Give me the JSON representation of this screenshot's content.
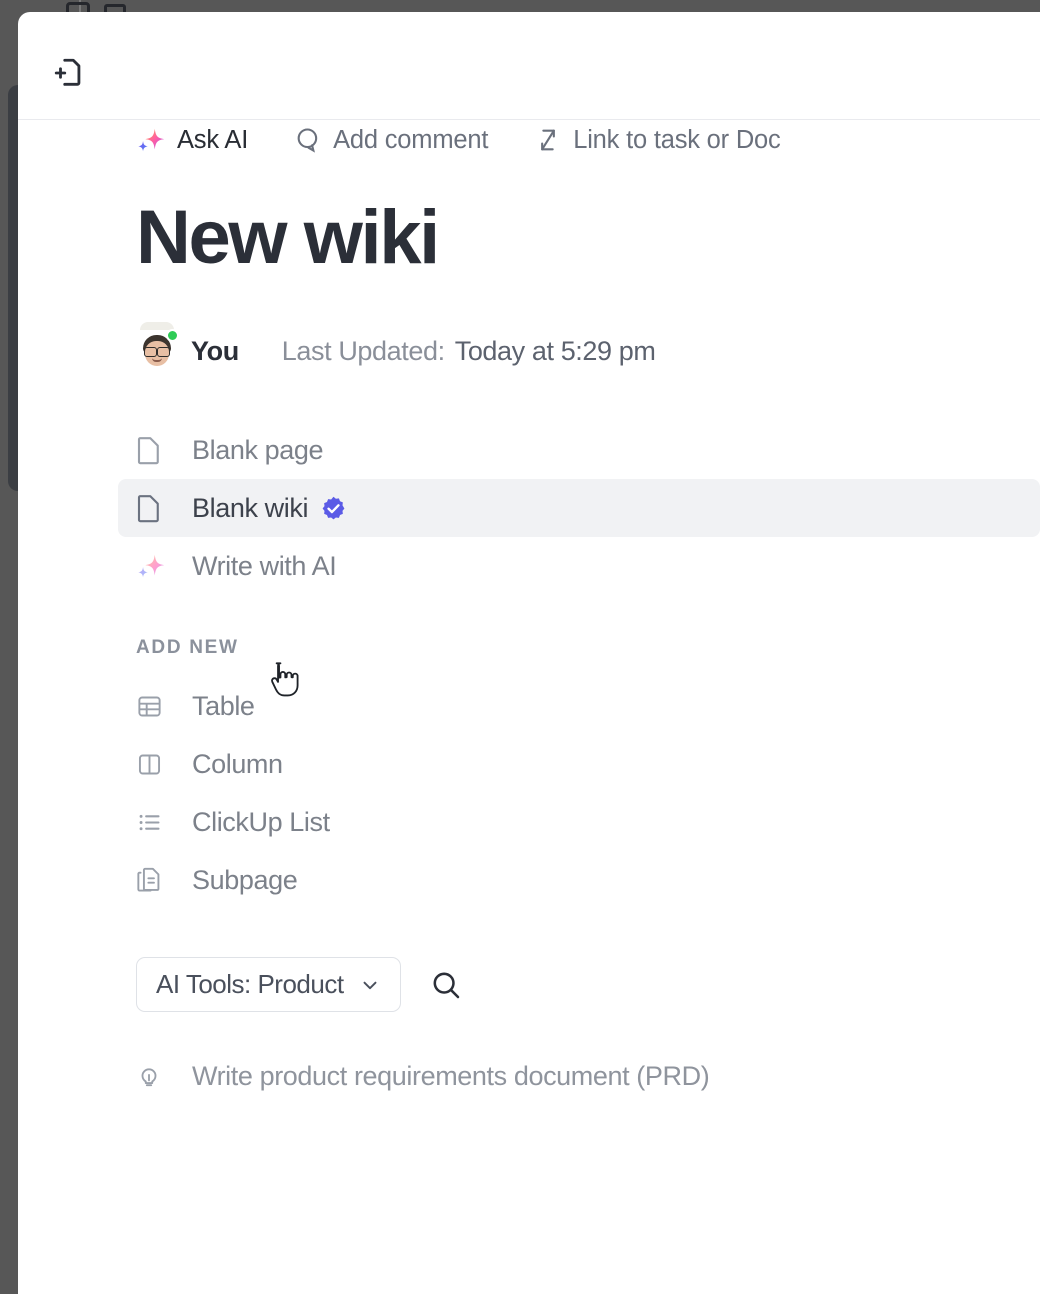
{
  "window": {
    "background_color": "#575757",
    "panel_background": "#ffffff",
    "sidebar_rail_color": "#3b3e43"
  },
  "header": {
    "new_page_icon": "new-page-icon"
  },
  "toolbar": {
    "items": [
      {
        "label": "Ask AI",
        "icon": "sparkle-icon",
        "emphasis": "dark"
      },
      {
        "label": "Add comment",
        "icon": "comment-icon",
        "emphasis": "muted"
      },
      {
        "label": "Link to task or Doc",
        "icon": "link-arrows-icon",
        "emphasis": "muted"
      }
    ]
  },
  "document": {
    "title": "New wiki",
    "author": "You",
    "updated_label": "Last Updated:",
    "updated_value": "Today at 5:29 pm",
    "avatar_name": "user-avatar",
    "status": "online"
  },
  "template_options": [
    {
      "label": "Blank page",
      "icon": "page-icon",
      "highlighted": false,
      "verified": false
    },
    {
      "label": "Blank wiki",
      "icon": "page-icon",
      "highlighted": true,
      "verified": true
    },
    {
      "label": "Write with AI",
      "icon": "sparkle-pastel-icon",
      "highlighted": false,
      "verified": false
    }
  ],
  "add_new": {
    "section_label": "ADD NEW",
    "items": [
      {
        "label": "Table",
        "icon": "table-icon"
      },
      {
        "label": "Column",
        "icon": "column-icon"
      },
      {
        "label": "ClickUp List",
        "icon": "bullet-list-icon"
      },
      {
        "label": "Subpage",
        "icon": "subpage-icon"
      }
    ]
  },
  "filter": {
    "dropdown_label": "AI Tools: Product",
    "dropdown_icon": "chevron-down-icon",
    "search_icon": "search-icon"
  },
  "prompts": [
    {
      "label": "Write product requirements document (PRD)",
      "icon": "lightbulb-icon"
    }
  ],
  "colors": {
    "accent_purple": "#5b5be6",
    "status_green": "#2ecb55",
    "avatar_lime": "#c9e03f",
    "highlight_row": "#f1f2f4",
    "muted_text": "#7c818a",
    "dark_text": "#2b2f38"
  }
}
